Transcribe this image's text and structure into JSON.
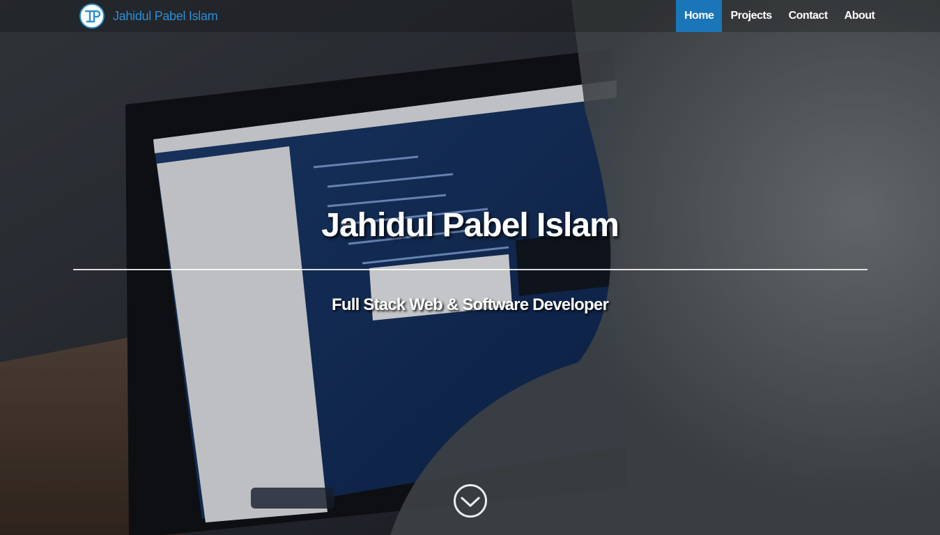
{
  "brand": {
    "name": "Jahidul Pabel Islam",
    "color": "#2b8ed6"
  },
  "nav": {
    "items": [
      {
        "label": "Home",
        "active": true
      },
      {
        "label": "Projects",
        "active": false
      },
      {
        "label": "Contact",
        "active": false
      },
      {
        "label": "About",
        "active": false
      }
    ],
    "active_color": "#1a75b9"
  },
  "hero": {
    "title": "Jahidul Pabel Islam",
    "subtitle": "Full Stack Web & Software Developer",
    "background": "photo of a laptop showing Xamarin Studio code editor",
    "scroll_icon": "chevron-down-circle-icon"
  }
}
